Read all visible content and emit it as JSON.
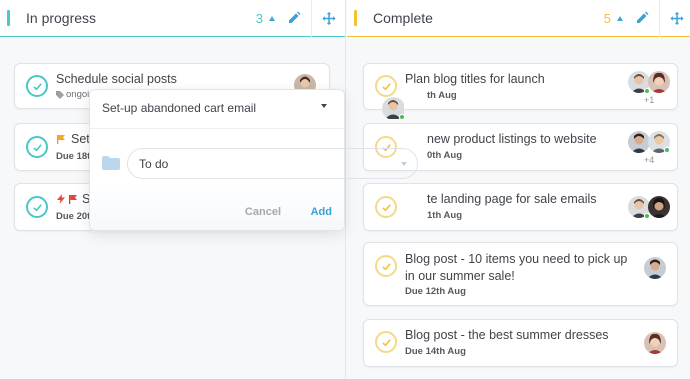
{
  "columns": {
    "in_progress": {
      "title": "In progress",
      "count": "3",
      "accent": "#49c7c9",
      "cards": [
        {
          "title": "Schedule social posts",
          "tag": "ongoi"
        },
        {
          "title": "Set-",
          "due": "Due 18t"
        },
        {
          "title": "S",
          "due": "Due 20t"
        }
      ]
    },
    "complete": {
      "title": "Complete",
      "count": "5",
      "accent": "#f4c234",
      "cards": [
        {
          "title": "Plan blog titles for launch",
          "due": "th Aug",
          "extra": "+1"
        },
        {
          "title": "new product listings to website",
          "due": "0th Aug",
          "extra": "+4"
        },
        {
          "title": "te landing page for sale emails",
          "due": "1th Aug"
        },
        {
          "title": "Blog post - 10 items you need to pick up in our summer sale!",
          "due": "Due 12th Aug"
        },
        {
          "title": "Blog post - the best summer dresses",
          "due": "Due 14th Aug"
        }
      ]
    }
  },
  "popover": {
    "title": "Set-up abandoned cart email",
    "select_value": "To do",
    "cancel_label": "Cancel",
    "add_label": "Add"
  },
  "colors": {
    "teal": "#49c7c9",
    "yellow": "#f4c234",
    "blue": "#42a5dc",
    "online": "#4cbb5a"
  },
  "icons": {
    "edit": "pencil-icon",
    "move": "move-arrows-icon",
    "folder": "folder-icon",
    "tag": "tag-icon"
  }
}
